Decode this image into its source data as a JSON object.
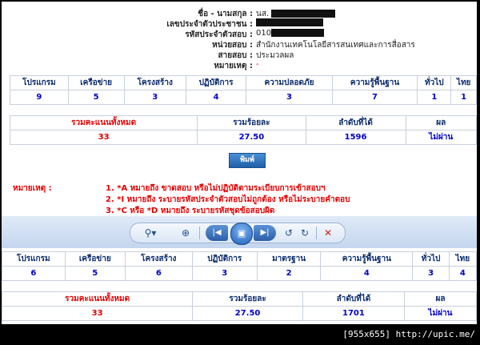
{
  "info": [
    {
      "label": "ชื่อ - นามสกุล :",
      "value": "นส."
    },
    {
      "label": "เลขประจำตัวประชาชน :",
      "value": ""
    },
    {
      "label": "รหัสประจำตัวสอบ :",
      "value": "010"
    },
    {
      "label": "หน่วยสอบ :",
      "value": "สำนักงานเทคโนโลยีสารสนเทศและการสื่อสาร"
    },
    {
      "label": "สายสอบ :",
      "value": "ประมวลผล"
    },
    {
      "label": "หมายเหตุ :",
      "value": "-"
    }
  ],
  "score1": {
    "headers": [
      "โปรแกรม",
      "เครือข่าย",
      "โครงสร้าง",
      "ปฏิบัติการ",
      "ความปลอดภัย",
      "ความรู้พื้นฐาน",
      "ทั่วไป",
      "ไทย"
    ],
    "values": [
      "9",
      "5",
      "3",
      "4",
      "3",
      "7",
      "1",
      "1"
    ]
  },
  "total1": {
    "headers": [
      "รวมคะแนนทั้งหมด",
      "รวมร้อยละ",
      "ลำดับที่ได้",
      "ผล"
    ],
    "values": [
      "33",
      "27.50",
      "1596",
      "ไม่ผ่าน"
    ]
  },
  "print_label": "พิมพ์",
  "notes": {
    "title": "หมายเหตุ :",
    "items": [
      "1. *A หมายถึง ขาดสอบ หรือไม่ปฏิบัติตามระเบียบการเข้าสอบฯ",
      "2. *I หมายถึง ระบายรหัสประจำตัวสอบไม่ถูกต้อง หรือไม่ระบายคำตอบ",
      "3. *C หรือ *D หมายถึง ระบายรหัสชุดข้อสอบผิด"
    ]
  },
  "score2": {
    "headers": [
      "โปรแกรม",
      "เครือข่าย",
      "โครงสร้าง",
      "ปฏิบัติการ",
      "มาตรฐาน",
      "ความรู้พื้นฐาน",
      "ทั่วไป",
      "ไทย"
    ],
    "values": [
      "6",
      "5",
      "6",
      "3",
      "2",
      "4",
      "3",
      "4"
    ]
  },
  "total2": {
    "headers": [
      "รวมคะแนนทั้งหมด",
      "รวมร้อยละ",
      "ลำดับที่ได้",
      "ผล"
    ],
    "values": [
      "33",
      "27.50",
      "1701",
      "ไม่ผ่าน"
    ]
  },
  "footer": "[955x655] http://upic.me/",
  "toolbar_icons": [
    "zoom-icon",
    "actual-size-icon",
    "previous-icon",
    "slideshow-icon",
    "next-icon",
    "rotate-left-icon",
    "rotate-right-icon",
    "delete-icon"
  ]
}
